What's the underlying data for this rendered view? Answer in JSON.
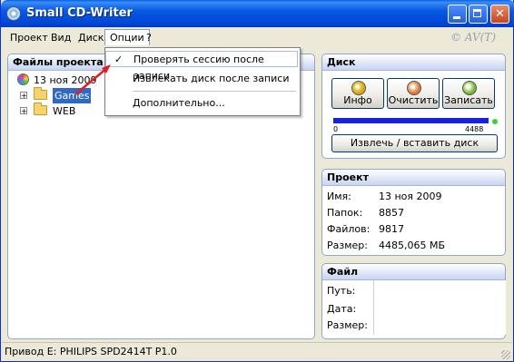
{
  "window": {
    "title": "Small CD-Writer",
    "copyright": "© AV(T)"
  },
  "menu": {
    "items": [
      "Проект",
      "Вид",
      "Диск",
      "Опции",
      "?"
    ]
  },
  "options_menu": {
    "items": [
      {
        "label": "Проверять сессию после записи",
        "checked": true
      },
      {
        "label": "Извлекать диск после записи",
        "checked": false
      },
      {
        "label": "Дополнительно...",
        "checked": false
      }
    ],
    "check_glyph": "✓"
  },
  "project_files": {
    "header": "Файлы проекта",
    "root": "13 ноя 2009",
    "children": [
      {
        "label": "Games",
        "selected": true
      },
      {
        "label": "WEB",
        "selected": false
      }
    ]
  },
  "disk": {
    "header": "Диск",
    "buttons": {
      "info": "Инфо",
      "clear": "Очистить",
      "write": "Записать"
    },
    "capacity_min": "0",
    "capacity_max": "4488",
    "eject_label": "Извлечь / вставить диск"
  },
  "project": {
    "header": "Проект",
    "rows": [
      {
        "key": "Имя:",
        "value": "13 ноя 2009"
      },
      {
        "key": "Папок:",
        "value": "8857"
      },
      {
        "key": "Файлов:",
        "value": "9817"
      },
      {
        "key": "Размер:",
        "value": "4485,065 МБ"
      }
    ]
  },
  "file": {
    "header": "Файл",
    "rows": [
      {
        "key": "Путь:"
      },
      {
        "key": "Дата:"
      },
      {
        "key": "Размер:"
      }
    ]
  },
  "statusbar": {
    "text": "Привод  E: PHILIPS SPD2414T P1.0"
  },
  "colors": {
    "title_blue": "#0054e3",
    "selection": "#316ac5",
    "capacity_bar": "#1822d6",
    "status_dot": "#3bd23b",
    "arrow_red": "#e02020"
  }
}
